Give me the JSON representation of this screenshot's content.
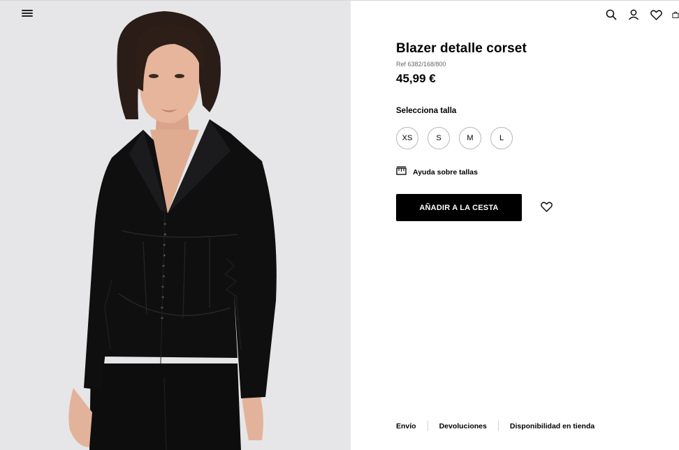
{
  "header": {
    "menu_icon": "hamburger-menu-icon",
    "icons": [
      "search-icon",
      "user-icon",
      "heart-icon",
      "bag-icon"
    ]
  },
  "product": {
    "title": "Blazer detalle corset",
    "ref": "Ref 6382/168/800",
    "price": "45,99 €",
    "image_description_icon": "model-photo"
  },
  "sizes": {
    "label": "Selecciona talla",
    "options": [
      "XS",
      "S",
      "M",
      "L"
    ]
  },
  "help": {
    "label": "Ayuda sobre tallas",
    "icon": "ruler-icon"
  },
  "actions": {
    "add_to_cart": "AÑADIR A LA CESTA",
    "wishlist_icon": "heart-icon"
  },
  "footer": {
    "links": [
      "Envío",
      "Devoluciones",
      "Disponibilidad en tienda"
    ]
  },
  "colors": {
    "primary_button_bg": "#000000",
    "image_bg": "#e6e6e8"
  }
}
